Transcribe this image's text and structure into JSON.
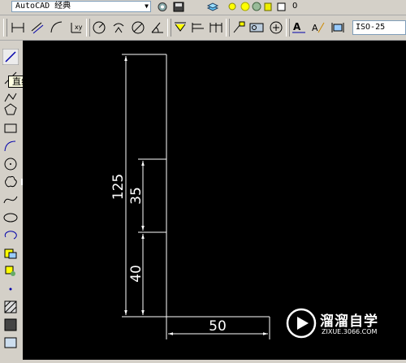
{
  "toolbar": {
    "workspace": "AutoCAD 经典",
    "layer_name": "0",
    "dim_style": "ISO-25"
  },
  "draw_toolbar": {
    "tooltip": "直线"
  },
  "drawing": {
    "dimensions": [
      {
        "label": "125"
      },
      {
        "label": "35"
      },
      {
        "label": "40"
      },
      {
        "label": "50"
      }
    ]
  },
  "watermark": {
    "name": "溜溜自学",
    "url": "ZIXUE.3066.COM"
  },
  "colors": {
    "canvas_bg": "#000000",
    "toolbar_bg": "#d4d0c8",
    "line_color": "#ffffff",
    "tooltip_bg": "#ffffe1"
  }
}
